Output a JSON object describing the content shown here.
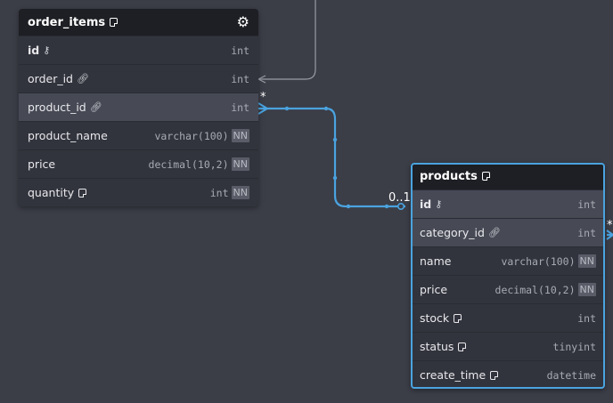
{
  "tables": [
    {
      "name": "order_items",
      "icon": "gear-icon",
      "fields": [
        {
          "name": "id",
          "type": "int",
          "pk": true,
          "icon": "key-icon",
          "nn": false
        },
        {
          "name": "order_id",
          "type": "int",
          "icon": "link-icon",
          "nn": false
        },
        {
          "name": "product_id",
          "type": "int",
          "icon": "link-icon",
          "nn": false,
          "highlight": true
        },
        {
          "name": "product_name",
          "type": "varchar(100)",
          "nn": true
        },
        {
          "name": "price",
          "type": "decimal(10,2)",
          "nn": true
        },
        {
          "name": "quantity",
          "type": "int",
          "icon": "note-icon",
          "nn": true
        }
      ]
    },
    {
      "name": "products",
      "selected": true,
      "fields": [
        {
          "name": "id",
          "type": "int",
          "pk": true,
          "icon": "key-icon",
          "nn": false,
          "highlight": true
        },
        {
          "name": "category_id",
          "type": "int",
          "icon": "link-icon",
          "nn": false,
          "highlight": true
        },
        {
          "name": "name",
          "type": "varchar(100)",
          "nn": true
        },
        {
          "name": "price",
          "type": "decimal(10,2)",
          "nn": true
        },
        {
          "name": "stock",
          "type": "int",
          "icon": "note-icon",
          "nn": false
        },
        {
          "name": "status",
          "type": "tinyint",
          "icon": "note-icon",
          "nn": false
        },
        {
          "name": "create_time",
          "type": "datetime",
          "icon": "note-icon",
          "nn": false
        }
      ]
    }
  ],
  "nn_label": "NN",
  "cardinality": {
    "many": "*",
    "zero_or_one": "0..1",
    "right_many": "*"
  },
  "colors": {
    "background": "#3b3d47",
    "relation_active": "#4aa3df",
    "relation_inactive": "#9a9ca6"
  }
}
